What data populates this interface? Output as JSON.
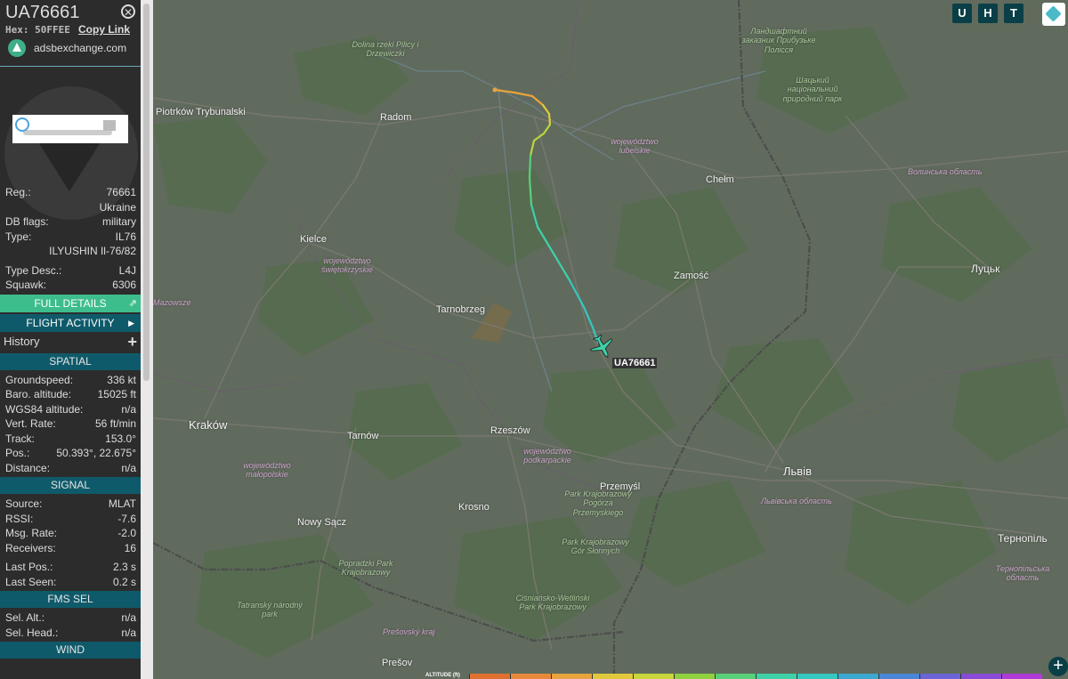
{
  "sidebar": {
    "callsign": "UA76661",
    "hex_label": "Hex:",
    "hex_value": "50FFEE",
    "copy_link": "Copy Link",
    "source_site": "adsbexchange.com",
    "fields_top": [
      {
        "key": "Reg.:",
        "value": "76661"
      },
      {
        "key": "",
        "value": "Ukraine"
      },
      {
        "key": "DB flags:",
        "value": "military"
      },
      {
        "key": "Type:",
        "value": "IL76"
      },
      {
        "key": "",
        "value": "ILYUSHIN Il-76/82"
      },
      {
        "key": "Type Desc.:",
        "value": "L4J"
      },
      {
        "key": "Squawk:",
        "value": "6306"
      }
    ],
    "full_details": "FULL DETAILS",
    "flight_activity": "FLIGHT ACTIVITY",
    "history": "History",
    "spatial_title": "SPATIAL",
    "spatial": [
      {
        "key": "Groundspeed:",
        "value": "336 kt"
      },
      {
        "key": "Baro. altitude:",
        "value": "15025 ft"
      },
      {
        "key": "WGS84 altitude:",
        "value": "n/a"
      },
      {
        "key": "Vert. Rate:",
        "value": "56 ft/min"
      },
      {
        "key": "Track:",
        "value": "153.0°"
      },
      {
        "key": "Pos.:",
        "value": "50.393°, 22.675°"
      },
      {
        "key": "Distance:",
        "value": "n/a"
      }
    ],
    "signal_title": "SIGNAL",
    "signal": [
      {
        "key": "Source:",
        "value": "MLAT"
      },
      {
        "key": "RSSI:",
        "value": "-7.6"
      },
      {
        "key": "Msg. Rate:",
        "value": "-2.0"
      },
      {
        "key": "Receivers:",
        "value": "16"
      },
      {
        "key": "Last Pos.:",
        "value": "2.3 s"
      },
      {
        "key": "Last Seen:",
        "value": "0.2 s"
      }
    ],
    "fms_title": "FMS SEL",
    "fms": [
      {
        "key": "Sel. Alt.:",
        "value": "n/a"
      },
      {
        "key": "Sel. Head.:",
        "value": "n/a"
      }
    ],
    "wind_title": "WIND"
  },
  "map": {
    "buttons": [
      "U",
      "H",
      "T"
    ],
    "aircraft_label": "UA76661",
    "altitude_legend": "ALTITUDE (ft)",
    "zoom_label": "+",
    "track_colors": [
      "#e8a33c",
      "#e2c93c",
      "#b8d63b",
      "#58d07a",
      "#3fd0a8",
      "#35c7c0"
    ],
    "places": [
      {
        "name": "Piotrków Trybunalski",
        "class": "city"
      },
      {
        "name": "Radom",
        "class": "city"
      },
      {
        "name": "Kielce",
        "class": "city"
      },
      {
        "name": "Chełm",
        "class": "city"
      },
      {
        "name": "Zamość",
        "class": "city"
      },
      {
        "name": "Луцьк",
        "class": "city"
      },
      {
        "name": "Tarnobrzeg",
        "class": "city"
      },
      {
        "name": "Kraków",
        "class": "bigcity"
      },
      {
        "name": "Tarnów",
        "class": "city"
      },
      {
        "name": "Rzeszów",
        "class": "city"
      },
      {
        "name": "Przemyśl",
        "class": "city"
      },
      {
        "name": "Львів",
        "class": "bigcity"
      },
      {
        "name": "Krosno",
        "class": "city"
      },
      {
        "name": "Nowy Sącz",
        "class": "city"
      },
      {
        "name": "Тернопіль",
        "class": "city"
      },
      {
        "name": "Prešov",
        "class": "city"
      },
      {
        "name": "województwo lubelskie",
        "class": "region"
      },
      {
        "name": "województwo świętokrzyskie",
        "class": "region"
      },
      {
        "name": "województwo podkarpackie",
        "class": "region"
      },
      {
        "name": "województwo małopolskie",
        "class": "region"
      },
      {
        "name": "Волинська область",
        "class": "region"
      },
      {
        "name": "Львівська область",
        "class": "region"
      },
      {
        "name": "Тернопільська область",
        "class": "region"
      },
      {
        "name": "Шацький національний природний парк",
        "class": "park"
      },
      {
        "name": "Ландшафтний заказник Прибузьке Полісся",
        "class": "park"
      },
      {
        "name": "Dolina rzeki Pilicy i Drzewiczki",
        "class": "park"
      },
      {
        "name": "Park Krajobrazowy Pogórza Przemyskiego",
        "class": "park"
      },
      {
        "name": "Park Krajobrazowy Gór Słonnych",
        "class": "park"
      },
      {
        "name": "Popradzki Park Krajobrazowy",
        "class": "park"
      },
      {
        "name": "Ciśniańsko-Wetliński Park Krajobrazowy",
        "class": "park"
      },
      {
        "name": "Tatranský národný park",
        "class": "park"
      },
      {
        "name": "Prešovský kraj",
        "class": "region"
      },
      {
        "name": "Mazowsze",
        "class": "region"
      }
    ]
  }
}
